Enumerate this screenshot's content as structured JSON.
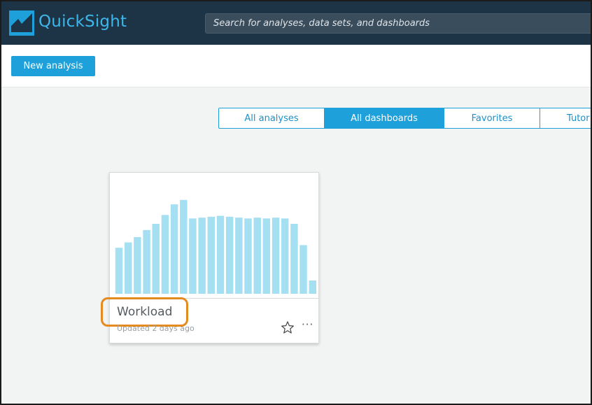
{
  "header": {
    "brand": "QuickSight",
    "search_placeholder": "Search for analyses, data sets, and dashboards",
    "brand_color": "#3db7ea",
    "bar_color": "#1d3447"
  },
  "toolbar": {
    "new_analysis_label": "New analysis"
  },
  "tabs": [
    {
      "label": "All analyses",
      "active": false
    },
    {
      "label": "All dashboards",
      "active": true
    },
    {
      "label": "Favorites",
      "active": false
    },
    {
      "label": "Tutor",
      "active": false
    }
  ],
  "card": {
    "title": "Workload",
    "updated": "Updated 2 days ago",
    "star_icon": "star-outline-icon",
    "more_icon": "ellipsis-icon",
    "more_label": "···",
    "thumbnail_bar_color": "#a5dff2",
    "thumbnail_values": [
      52,
      58,
      64,
      72,
      79,
      89,
      101,
      106,
      85,
      86,
      87,
      88,
      87,
      86,
      85,
      86,
      85,
      86,
      85,
      79,
      55,
      15
    ]
  }
}
